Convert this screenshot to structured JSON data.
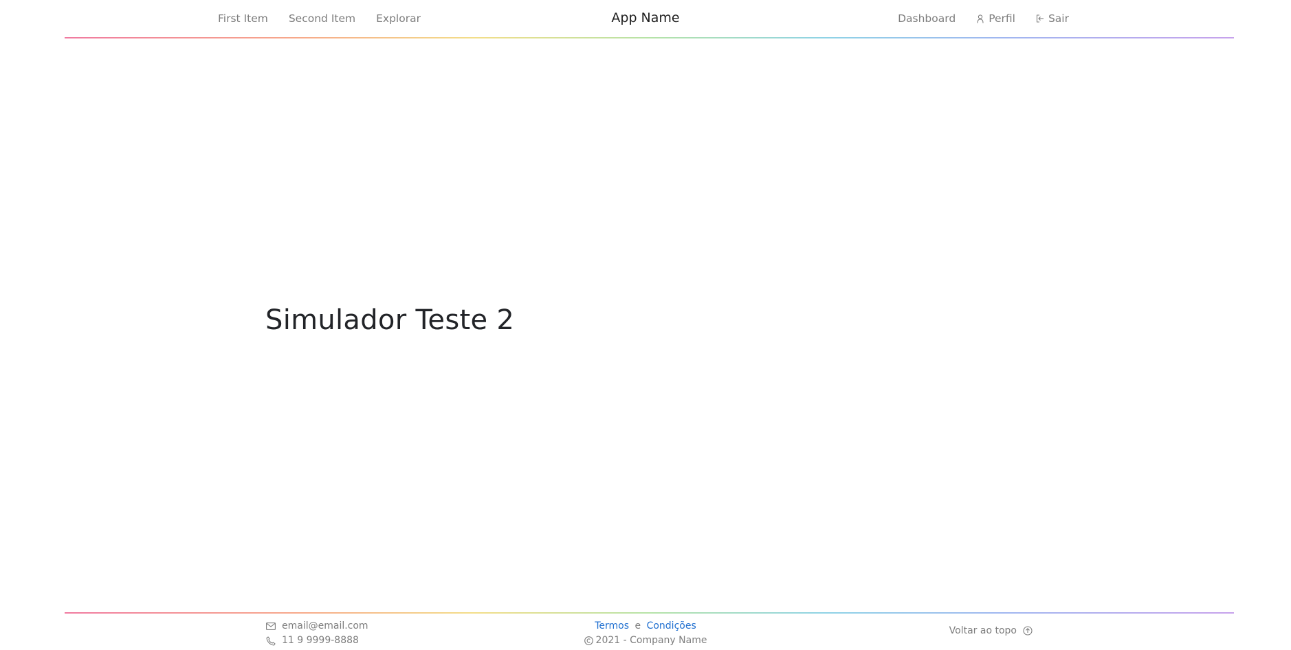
{
  "navbar": {
    "left_items": [
      {
        "label": "First Item"
      },
      {
        "label": "Second Item"
      },
      {
        "label": "Explorar"
      }
    ],
    "brand": "App Name",
    "right_items": [
      {
        "label": "Dashboard",
        "icon": ""
      },
      {
        "label": "Perfil",
        "icon": "person-icon"
      },
      {
        "label": "Sair",
        "icon": "logout-icon"
      }
    ]
  },
  "main": {
    "title": "Simulador Teste 2"
  },
  "footer": {
    "email": "email@email.com",
    "email_icon": "envelope-icon",
    "phone": "11 9 9999-8888",
    "phone_icon": "phone-icon",
    "terms_label": "Termos",
    "conjunction": "e",
    "conditions_label": "Condições",
    "copyright_text": "2021 - Company Name",
    "copyright_icon": "copyright-icon",
    "back_to_top_label": "Voltar ao topo",
    "back_to_top_icon": "arrow-up-circle-icon"
  },
  "colors": {
    "text_muted": "#7d7d7d",
    "text_dark": "#222428",
    "link": "#1f6fd0",
    "divider_gradient": [
      "#f07aa0",
      "#f7a98a",
      "#f3de89",
      "#b6e3a7",
      "#8fd3e6",
      "#a0b7f0",
      "#c7a2ec"
    ]
  }
}
